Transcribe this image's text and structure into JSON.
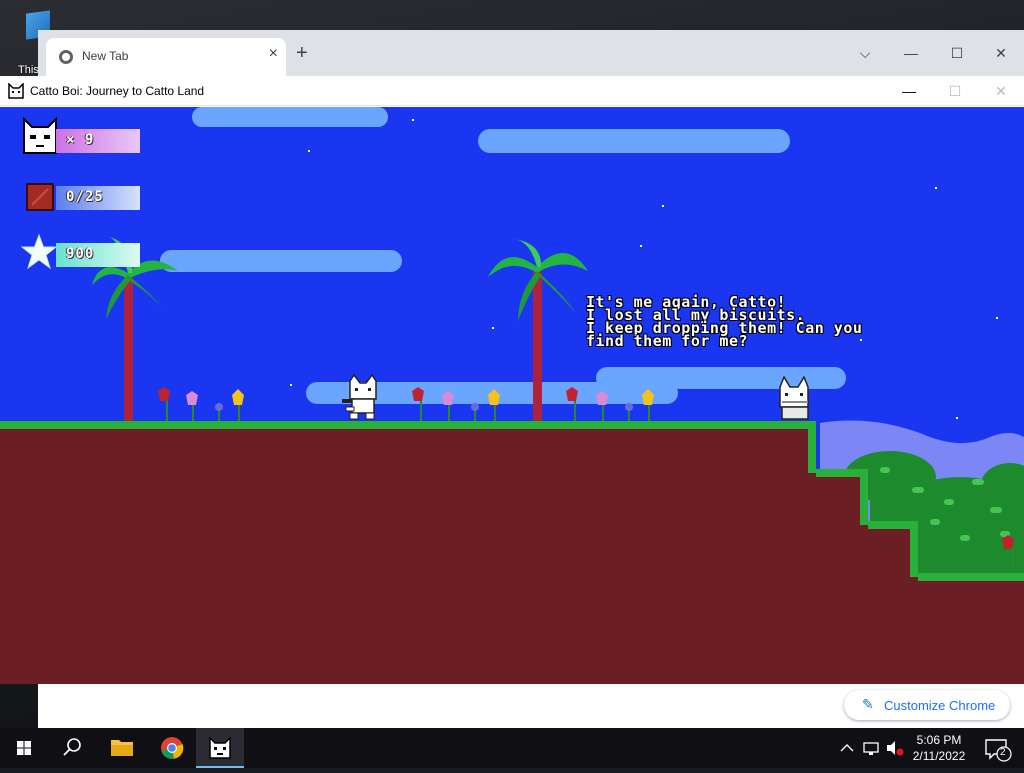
{
  "desktop": {
    "icon_label": "This"
  },
  "chrome": {
    "tab_title": "New Tab",
    "tab_close": "×",
    "new_tab": "+",
    "controls": {
      "dropdown": "⌵",
      "minimize": "—",
      "maximize": "☐",
      "close": "✕"
    },
    "customize_label": "Customize Chrome",
    "customize_icon": "pencil-icon"
  },
  "game_window": {
    "title": "Catto Boi: Journey to Catto Land",
    "controls": {
      "minimize": "—",
      "maximize": "☐",
      "close": "✕"
    }
  },
  "hud": {
    "lives": "× 9",
    "biscuits": "0/25",
    "score": "900"
  },
  "dialog": {
    "lines": [
      "It's me again, Catto!",
      "I lost all my biscuits.",
      "I keep dropping them! Can you",
      "find them for me?"
    ]
  },
  "taskbar": {
    "time": "5:06 PM",
    "date": "2/11/2022",
    "notification_count": "2",
    "icons": [
      "windows-start-icon",
      "search-icon",
      "file-explorer-icon",
      "chrome-icon",
      "catto-game-icon"
    ]
  },
  "colors": {
    "sky": "#1a36f0",
    "ground": "#6b1f25",
    "grass": "#29b03a",
    "cloud": "#6aa6ff"
  }
}
